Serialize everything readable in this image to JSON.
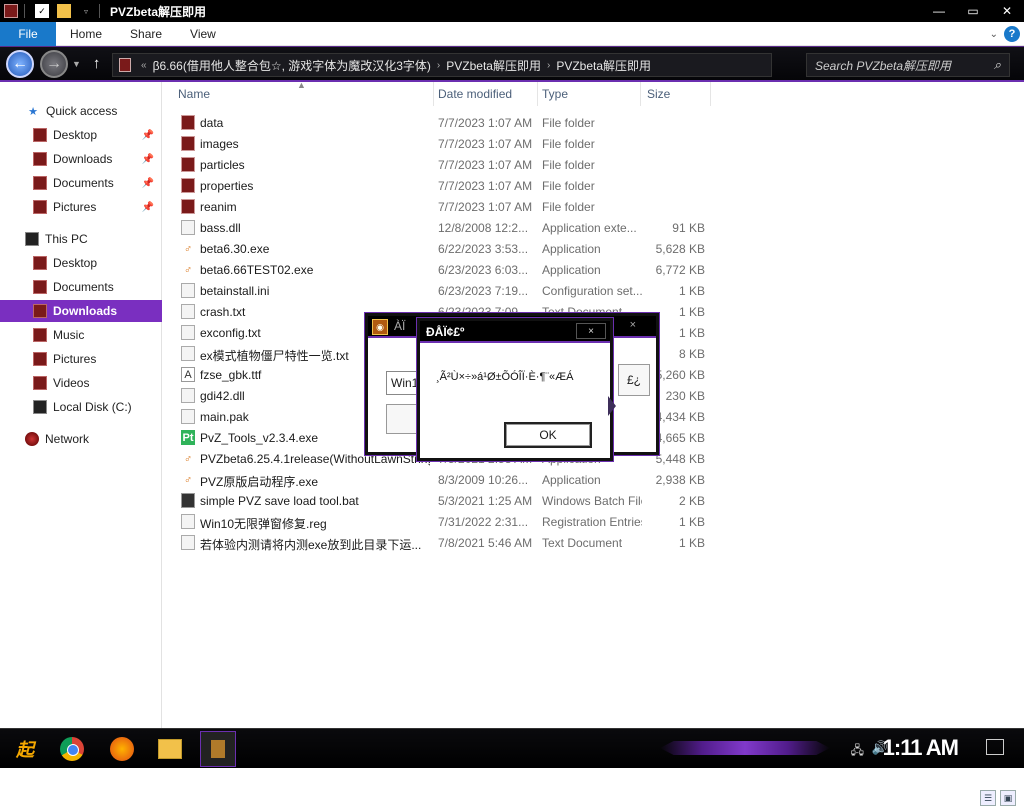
{
  "window": {
    "title": "PVZbeta解压即用"
  },
  "ribbon": {
    "tabs": [
      "File",
      "Home",
      "Share",
      "View"
    ]
  },
  "address": {
    "crumbs": [
      "β6.66(借用他人整合包☆, 游戏字体为魔改汉化3字体)",
      "PVZbeta解压即用",
      "PVZbeta解压即用"
    ],
    "search_placeholder": "Search PVZbeta解压即用"
  },
  "nav": {
    "quick_access": "Quick access",
    "qa_items": [
      "Desktop",
      "Downloads",
      "Documents",
      "Pictures"
    ],
    "this_pc": "This PC",
    "pc_items": [
      "Desktop",
      "Documents",
      "Downloads",
      "Music",
      "Pictures",
      "Videos",
      "Local Disk (C:)"
    ],
    "network": "Network",
    "selected": "Downloads"
  },
  "columns": {
    "name": "Name",
    "date": "Date modified",
    "type": "Type",
    "size": "Size"
  },
  "files": [
    {
      "name": "data",
      "date": "7/7/2023 1:07 AM",
      "type": "File folder",
      "size": "",
      "icon": "folder-icon"
    },
    {
      "name": "images",
      "date": "7/7/2023 1:07 AM",
      "type": "File folder",
      "size": "",
      "icon": "folder-icon"
    },
    {
      "name": "particles",
      "date": "7/7/2023 1:07 AM",
      "type": "File folder",
      "size": "",
      "icon": "folder-icon"
    },
    {
      "name": "properties",
      "date": "7/7/2023 1:07 AM",
      "type": "File folder",
      "size": "",
      "icon": "folder-icon"
    },
    {
      "name": "reanim",
      "date": "7/7/2023 1:07 AM",
      "type": "File folder",
      "size": "",
      "icon": "folder-icon"
    },
    {
      "name": "bass.dll",
      "date": "12/8/2008 12:2...",
      "type": "Application exte...",
      "size": "91 KB",
      "icon": "file-icon"
    },
    {
      "name": "beta6.30.exe",
      "date": "6/22/2023 3:53...",
      "type": "Application",
      "size": "5,628 KB",
      "icon": "exe-icon"
    },
    {
      "name": "beta6.66TEST02.exe",
      "date": "6/23/2023 6:03...",
      "type": "Application",
      "size": "6,772 KB",
      "icon": "exe-icon"
    },
    {
      "name": "betainstall.ini",
      "date": "6/23/2023 7:19...",
      "type": "Configuration set...",
      "size": "1 KB",
      "icon": "file-icon"
    },
    {
      "name": "crash.txt",
      "date": "6/23/2023 7:09...",
      "type": "Text Document",
      "size": "1 KB",
      "icon": "file-icon"
    },
    {
      "name": "exconfig.txt",
      "date": "",
      "type": "",
      "size": "1 KB",
      "icon": "file-icon"
    },
    {
      "name": "ex模式植物僵尸特性一览.txt",
      "date": "",
      "type": "",
      "size": "8 KB",
      "icon": "file-icon"
    },
    {
      "name": "fzse_gbk.ttf",
      "date": "",
      "type": "",
      "size": "5,260 KB",
      "icon": "font-icon"
    },
    {
      "name": "gdi42.dll",
      "date": "",
      "type": "",
      "size": "230 KB",
      "icon": "file-icon"
    },
    {
      "name": "main.pak",
      "date": "",
      "type": "",
      "size": "4,434 KB",
      "icon": "file-icon"
    },
    {
      "name": "PvZ_Tools_v2.3.4.exe",
      "date": "",
      "type": "",
      "size": "4,665 KB",
      "icon": "pt-icon"
    },
    {
      "name": "PVZbeta6.25.4.1release(WithoutLawnStrings...",
      "date": "7/5/2021 2:58 AM",
      "type": "Application",
      "size": "5,448 KB",
      "icon": "exe-icon"
    },
    {
      "name": "PVZ原版启动程序.exe",
      "date": "8/3/2009 10:26...",
      "type": "Application",
      "size": "2,938 KB",
      "icon": "exe-icon"
    },
    {
      "name": "simple PVZ save load tool.bat",
      "date": "5/3/2021 1:25 AM",
      "type": "Windows Batch File",
      "size": "2 KB",
      "icon": "bat-icon"
    },
    {
      "name": "Win10无限弹窗修复.reg",
      "date": "7/31/2022 2:31...",
      "type": "Registration Entries",
      "size": "1 KB",
      "icon": "file-icon"
    },
    {
      "name": "若体验内测请将内测exe放到此目录下运...",
      "date": "7/8/2021 5:46 AM",
      "type": "Text Document",
      "size": "1 KB",
      "icon": "file-icon"
    }
  ],
  "back_dialog": {
    "title": "ÀÏ",
    "input_value": "Win10",
    "side_button": "£¿",
    "close": "×"
  },
  "msgbox": {
    "title": "ÐÅÏ¢£º",
    "message": "¸Ã²Ù×÷»á¹Ø±ÕÓÎÏ·È·¶¨«ÆÁ",
    "ok": "OK",
    "close": "×"
  },
  "taskbar": {
    "start": "起",
    "clock": "1:11 AM"
  },
  "colors": {
    "accent": "#7a2fc0",
    "file_tab": "#1979ca"
  }
}
